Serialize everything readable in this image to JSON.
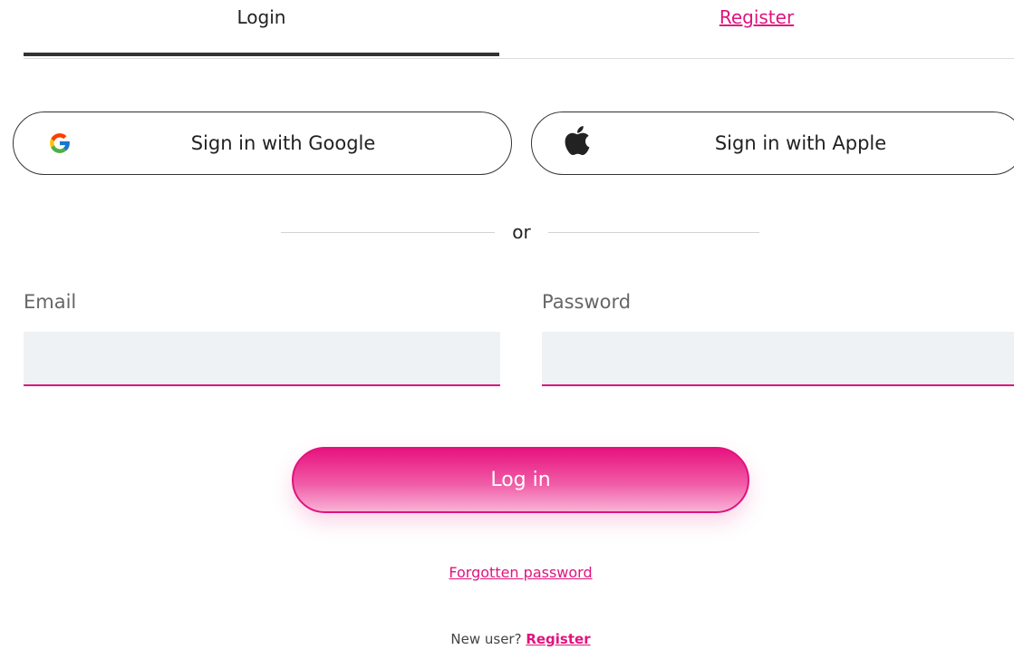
{
  "tabs": {
    "login": "Login",
    "register": "Register"
  },
  "social": {
    "google_label": "Sign in with Google",
    "apple_label": "Sign in with Apple",
    "google_icon": "google-g-icon",
    "apple_icon": "apple-logo-icon"
  },
  "divider_text": "or",
  "form": {
    "email_label": "Email",
    "email_value": "",
    "email_placeholder": "",
    "password_label": "Password",
    "password_value": "",
    "password_placeholder": ""
  },
  "login_button": "Log in",
  "forgot_password": "Forgotten password",
  "footer": {
    "prompt": "New user?",
    "register_link": "Register"
  },
  "colors": {
    "accent": "#e0137e",
    "input_bg": "#eff2f5",
    "active_tab_underline": "#333333"
  }
}
